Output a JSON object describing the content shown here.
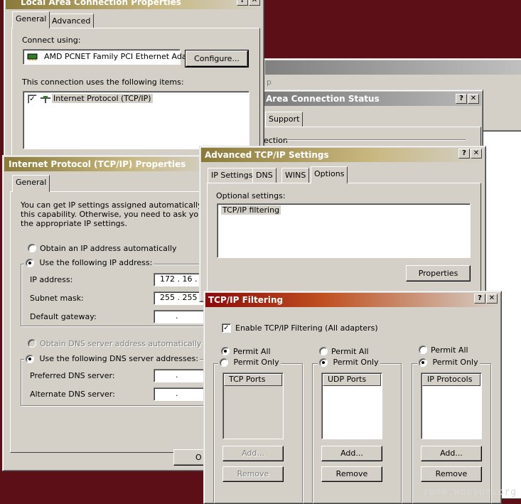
{
  "lan_props": {
    "title": "Local Area Connection Properties",
    "tabs": [
      "General",
      "Advanced"
    ],
    "connect_using_label": "Connect using:",
    "adapter": "AMD PCNET Family PCI Ethernet Ada",
    "configure_btn": "Configure...",
    "items_label": "This connection uses the following items:",
    "items": [
      {
        "label": "Internet Protocol (TCP/IP)",
        "checked": true
      }
    ]
  },
  "status_win": {
    "title": "Area Connection Status",
    "tab_support": "Support",
    "section_fragment": "ection"
  },
  "back_win": {
    "title_fragment": "p"
  },
  "tcpip_props": {
    "title": "Internet Protocol (TCP/IP) Properties",
    "tab": "General",
    "intro": [
      "You can get IP settings assigned automatically if your",
      "this capability. Otherwise, you need to ask your netwo",
      "the appropriate IP settings."
    ],
    "obtain_auto": "Obtain an IP address automatically",
    "use_following": "Use the following IP address:",
    "ip_label": "IP address:",
    "ip_value": "172 . 16 .",
    "mask_label": "Subnet mask:",
    "mask_value": "255 . 255 .",
    "gateway_label": "Default gateway:",
    "gateway_value": ".",
    "obtain_dns": "Obtain DNS server address automatically",
    "use_dns": "Use the following DNS server addresses:",
    "pref_dns_label": "Preferred DNS server:",
    "pref_dns_value": ".",
    "alt_dns_label": "Alternate DNS server:",
    "alt_dns_value": ".",
    "ok_fragment": "O"
  },
  "adv_tcpip": {
    "title": "Advanced TCP/IP Settings",
    "tabs": [
      "IP Settings",
      "DNS",
      "WINS",
      "Options"
    ],
    "optional_label": "Optional settings:",
    "optional_items": [
      "TCP/IP filtering"
    ],
    "properties_btn": "Properties"
  },
  "filtering": {
    "title": "TCP/IP Filtering",
    "enable_label": "Enable TCP/IP Filtering (All adapters)",
    "enable_checked": true,
    "columns": [
      {
        "permit_all": "Permit All",
        "permit_only": "Permit Only",
        "selected": "all",
        "header": "TCP Ports",
        "add": "Add...",
        "remove": "Remove",
        "enabled": false
      },
      {
        "permit_all": "Permit All",
        "permit_only": "Permit Only",
        "selected": "only",
        "header": "UDP Ports",
        "add": "Add...",
        "remove": "Remove",
        "enabled": true
      },
      {
        "permit_all": "Permit All",
        "permit_only": "Permit Only",
        "selected": "only",
        "header": "IP Protocols",
        "add": "Add...",
        "remove": "Remove",
        "enabled": true
      }
    ]
  },
  "help_glyph": "?",
  "close_glyph": "✕",
  "checkmark": "✓",
  "watermark": "zone.wooyun.org",
  "colors": {
    "desktop": "#5c0f16",
    "face": "#d4d0c8",
    "active_title_start": "#8c0a0a"
  }
}
